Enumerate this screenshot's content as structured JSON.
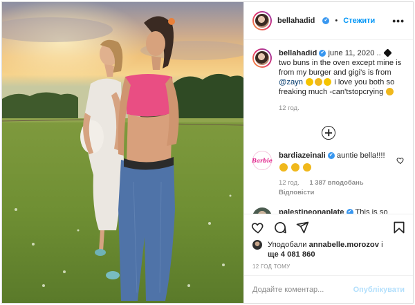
{
  "profile": {
    "username": "bellahadid",
    "verified_mark": "✔",
    "dot": "•",
    "follow_label": "Стежити",
    "more_label": "•••"
  },
  "caption": {
    "username": "bellahadid",
    "date": "june 11, 2020 ..",
    "text_part1": "two buns in the oven except mine is from my burger and gigi's is from",
    "mention": "@zayn",
    "text_part2": "i love you both so freaking much -can'tstopcrying",
    "time": "12 год."
  },
  "comments": [
    {
      "username": "bardiazeinali",
      "avatar_text": "Barbie",
      "text": "auntie bella!!!!",
      "time": "12 год.",
      "likes": "1 387 вподобань",
      "reply": "Відповісти"
    },
    {
      "username": "palestineonaplate",
      "text": "This is so cute"
    }
  ],
  "likes": {
    "prefix": "Уподобали",
    "user": "annabelle.morozov",
    "middle": "і",
    "also": "ще",
    "count": "4 081 860"
  },
  "timestamp": "12 год тому",
  "add_comment": {
    "placeholder": "Додайте коментар...",
    "publish_label": "Опублікувати"
  },
  "icons": [
    "heart-icon",
    "comment-icon",
    "share-icon",
    "bookmark-icon",
    "add-circle-icon",
    "verified-icon"
  ],
  "colors": {
    "link": "#0095f6",
    "mention": "#00376b",
    "muted": "#8e8e8e",
    "publish_disabled": "#b2dffc"
  }
}
